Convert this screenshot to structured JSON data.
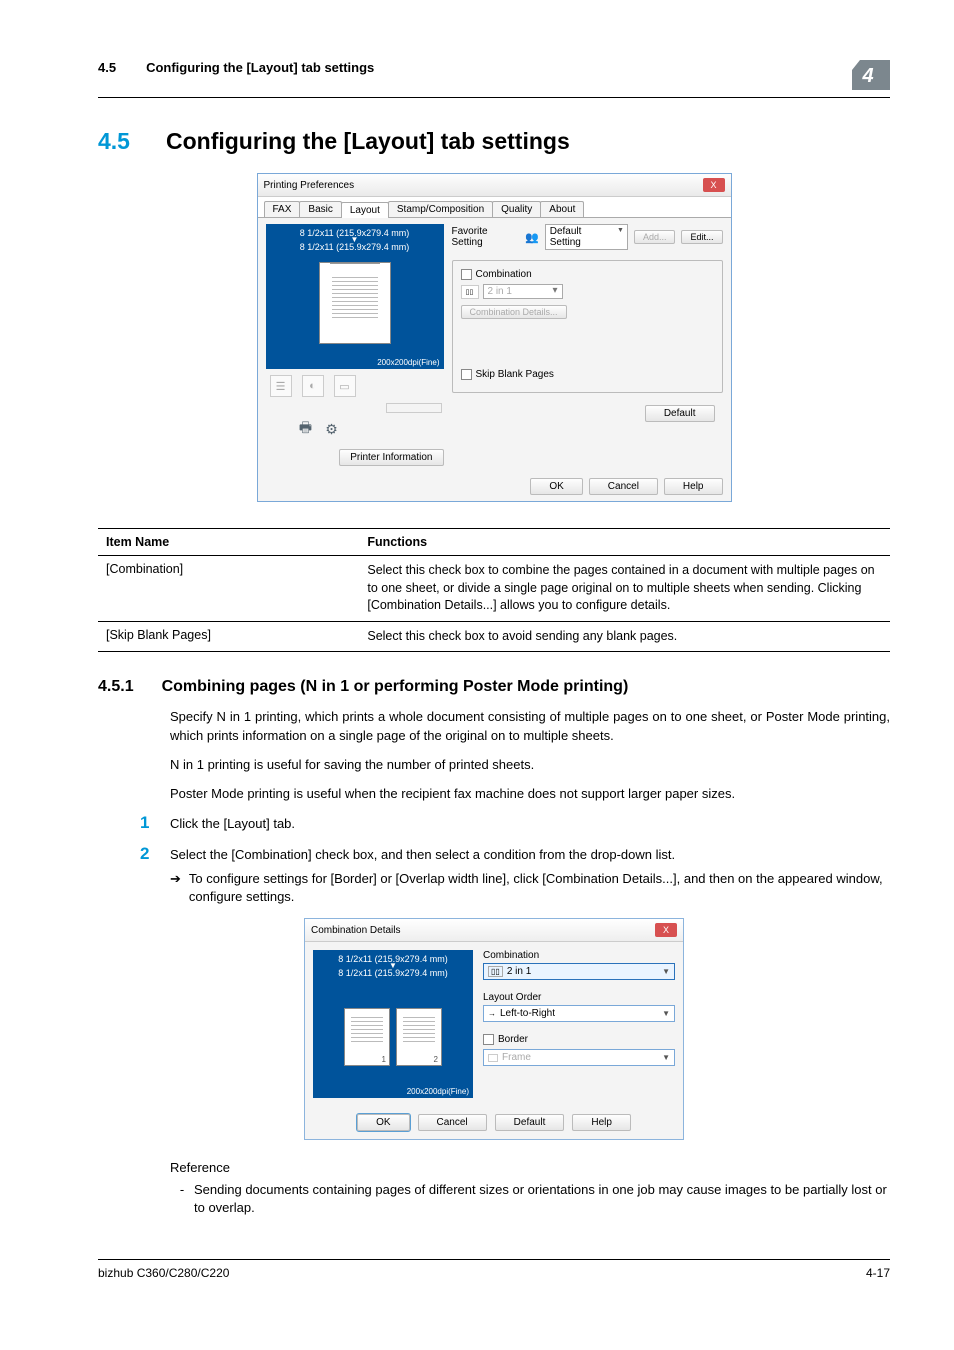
{
  "header": {
    "section_num": "4.5",
    "section_label": "Configuring the [Layout] tab settings",
    "badge": "4"
  },
  "title": {
    "num": "4.5",
    "text": "Configuring the [Layout] tab settings"
  },
  "printing_dialog": {
    "window_title": "Printing Preferences",
    "close": "X",
    "tabs": [
      "FAX",
      "Basic",
      "Layout",
      "Stamp/Composition",
      "Quality",
      "About"
    ],
    "active_tab_index": 2,
    "dim1": "8 1/2x11 (215.9x279.4 mm)",
    "dim2": "8 1/2x11 (215.9x279.4 mm)",
    "resolution": "200x200dpi(Fine)",
    "printer_info_btn": "Printer Information",
    "favorite_label": "Favorite Setting",
    "favorite_value": "Default Setting",
    "add_btn": "Add...",
    "edit_btn": "Edit...",
    "combination_label": "Combination",
    "combination_value": "2 in 1",
    "combination_details_btn": "Combination Details...",
    "skip_blank": "Skip Blank Pages",
    "default_btn": "Default",
    "ok_btn": "OK",
    "cancel_btn": "Cancel",
    "help_btn": "Help"
  },
  "info_table": {
    "head_item": "Item Name",
    "head_func": "Functions",
    "rows": [
      {
        "name": "[Combination]",
        "func": "Select this check box to combine the pages contained in a document with multiple pages on to one sheet, or divide a single page original on to multiple sheets when sending. Clicking [Combination Details...] allows you to configure details."
      },
      {
        "name": "[Skip Blank Pages]",
        "func": "Select this check box to avoid sending any blank pages."
      }
    ]
  },
  "subsection": {
    "num": "4.5.1",
    "title": "Combining pages (N in 1 or performing Poster Mode printing)",
    "para1": "Specify N in 1 printing, which prints a whole document consisting of multiple pages on to one sheet, or Poster Mode printing, which prints information on a single page of the original on to multiple sheets.",
    "para2": "N in 1 printing is useful for saving the number of printed sheets.",
    "para3": "Poster Mode printing is useful when the recipient fax machine does not support larger paper sizes.",
    "step1": "Click the [Layout] tab.",
    "step2": "Select the [Combination] check box, and then select a condition from the drop-down list.",
    "step2_sub": "To configure settings for [Border] or [Overlap width line], click [Combination Details...], and then on the appeared window, configure settings."
  },
  "combo_dialog": {
    "title": "Combination Details",
    "close": "X",
    "dim1": "8 1/2x11 (215.9x279.4 mm)",
    "dim2": "8 1/2x11 (215.9x279.4 mm)",
    "resolution": "200x200dpi(Fine)",
    "combination_label": "Combination",
    "combination_value": "2 in 1",
    "layout_order_label": "Layout Order",
    "layout_order_value": "Left-to-Right",
    "border_label": "Border",
    "frame_value": "Frame",
    "ok": "OK",
    "cancel": "Cancel",
    "default": "Default",
    "help": "Help"
  },
  "reference": {
    "heading": "Reference",
    "bullet": "Sending documents containing pages of different sizes or orientations in one job may cause images to be partially lost or to overlap."
  },
  "footer": {
    "model": "bizhub C360/C280/C220",
    "page": "4-17"
  }
}
